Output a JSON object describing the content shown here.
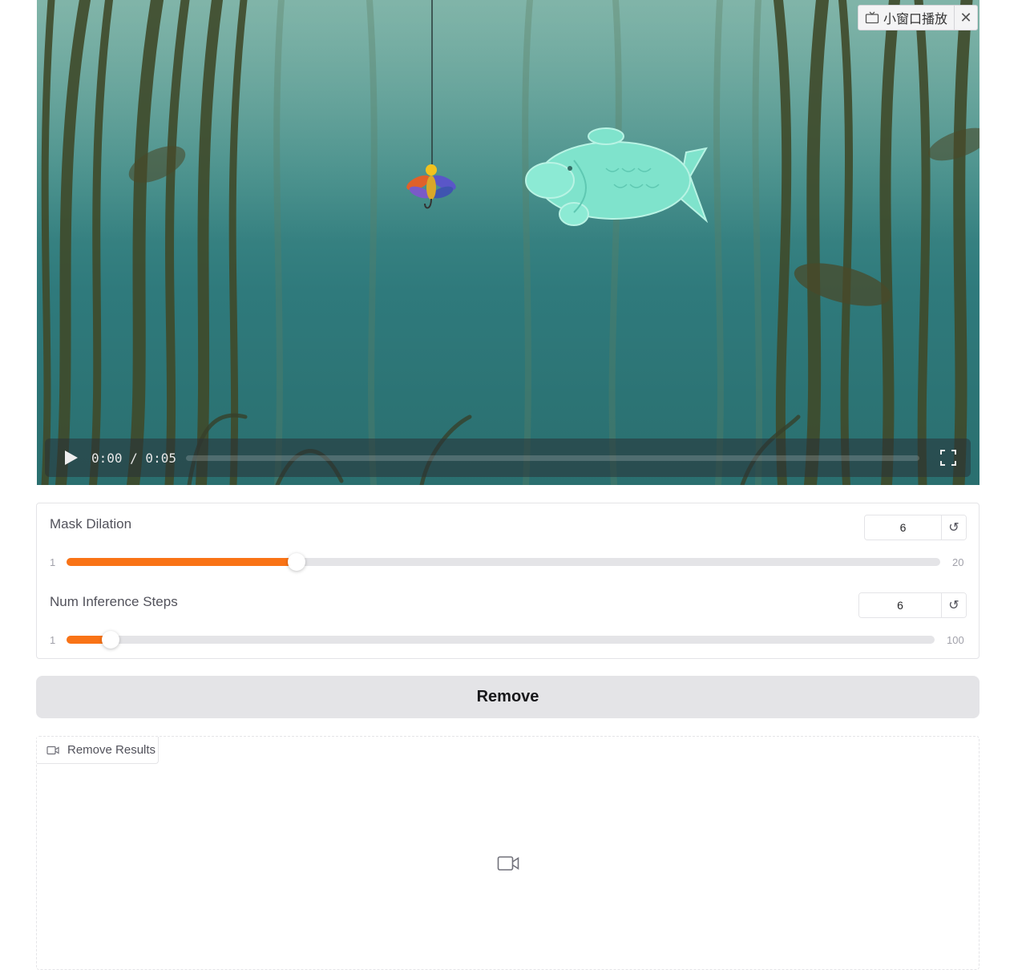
{
  "video_player": {
    "pip_label": "小窗口播放",
    "pip_close": "✕",
    "time_display": "0:00 / 0:05",
    "progress": 0
  },
  "sliders": [
    {
      "label": "Mask Dilation",
      "value": "6",
      "min": "1",
      "max": "20",
      "fraction": 0.2632,
      "reset": "↺"
    },
    {
      "label": "Num Inference Steps",
      "value": "6",
      "min": "1",
      "max": "100",
      "fraction": 0.0505,
      "reset": "↺"
    }
  ],
  "remove_button": {
    "label": "Remove"
  },
  "results": {
    "label": "Remove Results"
  },
  "colors": {
    "accent": "#f97316",
    "button_bg": "#e4e4e7",
    "border": "#e4e4e7"
  },
  "icons": {
    "pip": "tv-icon",
    "close": "close-icon",
    "play": "play-icon",
    "fullscreen": "fullscreen-icon",
    "reset": "reset-icon",
    "video": "video-camera-icon"
  }
}
